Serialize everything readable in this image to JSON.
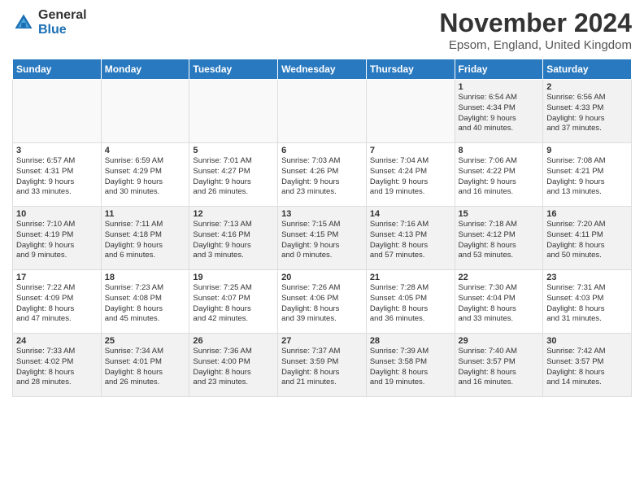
{
  "logo": {
    "general": "General",
    "blue": "Blue"
  },
  "title": "November 2024",
  "location": "Epsom, England, United Kingdom",
  "days_of_week": [
    "Sunday",
    "Monday",
    "Tuesday",
    "Wednesday",
    "Thursday",
    "Friday",
    "Saturday"
  ],
  "weeks": [
    [
      {
        "day": "",
        "info": ""
      },
      {
        "day": "",
        "info": ""
      },
      {
        "day": "",
        "info": ""
      },
      {
        "day": "",
        "info": ""
      },
      {
        "day": "",
        "info": ""
      },
      {
        "day": "1",
        "info": "Sunrise: 6:54 AM\nSunset: 4:34 PM\nDaylight: 9 hours\nand 40 minutes."
      },
      {
        "day": "2",
        "info": "Sunrise: 6:56 AM\nSunset: 4:33 PM\nDaylight: 9 hours\nand 37 minutes."
      }
    ],
    [
      {
        "day": "3",
        "info": "Sunrise: 6:57 AM\nSunset: 4:31 PM\nDaylight: 9 hours\nand 33 minutes."
      },
      {
        "day": "4",
        "info": "Sunrise: 6:59 AM\nSunset: 4:29 PM\nDaylight: 9 hours\nand 30 minutes."
      },
      {
        "day": "5",
        "info": "Sunrise: 7:01 AM\nSunset: 4:27 PM\nDaylight: 9 hours\nand 26 minutes."
      },
      {
        "day": "6",
        "info": "Sunrise: 7:03 AM\nSunset: 4:26 PM\nDaylight: 9 hours\nand 23 minutes."
      },
      {
        "day": "7",
        "info": "Sunrise: 7:04 AM\nSunset: 4:24 PM\nDaylight: 9 hours\nand 19 minutes."
      },
      {
        "day": "8",
        "info": "Sunrise: 7:06 AM\nSunset: 4:22 PM\nDaylight: 9 hours\nand 16 minutes."
      },
      {
        "day": "9",
        "info": "Sunrise: 7:08 AM\nSunset: 4:21 PM\nDaylight: 9 hours\nand 13 minutes."
      }
    ],
    [
      {
        "day": "10",
        "info": "Sunrise: 7:10 AM\nSunset: 4:19 PM\nDaylight: 9 hours\nand 9 minutes."
      },
      {
        "day": "11",
        "info": "Sunrise: 7:11 AM\nSunset: 4:18 PM\nDaylight: 9 hours\nand 6 minutes."
      },
      {
        "day": "12",
        "info": "Sunrise: 7:13 AM\nSunset: 4:16 PM\nDaylight: 9 hours\nand 3 minutes."
      },
      {
        "day": "13",
        "info": "Sunrise: 7:15 AM\nSunset: 4:15 PM\nDaylight: 9 hours\nand 0 minutes."
      },
      {
        "day": "14",
        "info": "Sunrise: 7:16 AM\nSunset: 4:13 PM\nDaylight: 8 hours\nand 57 minutes."
      },
      {
        "day": "15",
        "info": "Sunrise: 7:18 AM\nSunset: 4:12 PM\nDaylight: 8 hours\nand 53 minutes."
      },
      {
        "day": "16",
        "info": "Sunrise: 7:20 AM\nSunset: 4:11 PM\nDaylight: 8 hours\nand 50 minutes."
      }
    ],
    [
      {
        "day": "17",
        "info": "Sunrise: 7:22 AM\nSunset: 4:09 PM\nDaylight: 8 hours\nand 47 minutes."
      },
      {
        "day": "18",
        "info": "Sunrise: 7:23 AM\nSunset: 4:08 PM\nDaylight: 8 hours\nand 45 minutes."
      },
      {
        "day": "19",
        "info": "Sunrise: 7:25 AM\nSunset: 4:07 PM\nDaylight: 8 hours\nand 42 minutes."
      },
      {
        "day": "20",
        "info": "Sunrise: 7:26 AM\nSunset: 4:06 PM\nDaylight: 8 hours\nand 39 minutes."
      },
      {
        "day": "21",
        "info": "Sunrise: 7:28 AM\nSunset: 4:05 PM\nDaylight: 8 hours\nand 36 minutes."
      },
      {
        "day": "22",
        "info": "Sunrise: 7:30 AM\nSunset: 4:04 PM\nDaylight: 8 hours\nand 33 minutes."
      },
      {
        "day": "23",
        "info": "Sunrise: 7:31 AM\nSunset: 4:03 PM\nDaylight: 8 hours\nand 31 minutes."
      }
    ],
    [
      {
        "day": "24",
        "info": "Sunrise: 7:33 AM\nSunset: 4:02 PM\nDaylight: 8 hours\nand 28 minutes."
      },
      {
        "day": "25",
        "info": "Sunrise: 7:34 AM\nSunset: 4:01 PM\nDaylight: 8 hours\nand 26 minutes."
      },
      {
        "day": "26",
        "info": "Sunrise: 7:36 AM\nSunset: 4:00 PM\nDaylight: 8 hours\nand 23 minutes."
      },
      {
        "day": "27",
        "info": "Sunrise: 7:37 AM\nSunset: 3:59 PM\nDaylight: 8 hours\nand 21 minutes."
      },
      {
        "day": "28",
        "info": "Sunrise: 7:39 AM\nSunset: 3:58 PM\nDaylight: 8 hours\nand 19 minutes."
      },
      {
        "day": "29",
        "info": "Sunrise: 7:40 AM\nSunset: 3:57 PM\nDaylight: 8 hours\nand 16 minutes."
      },
      {
        "day": "30",
        "info": "Sunrise: 7:42 AM\nSunset: 3:57 PM\nDaylight: 8 hours\nand 14 minutes."
      }
    ]
  ]
}
